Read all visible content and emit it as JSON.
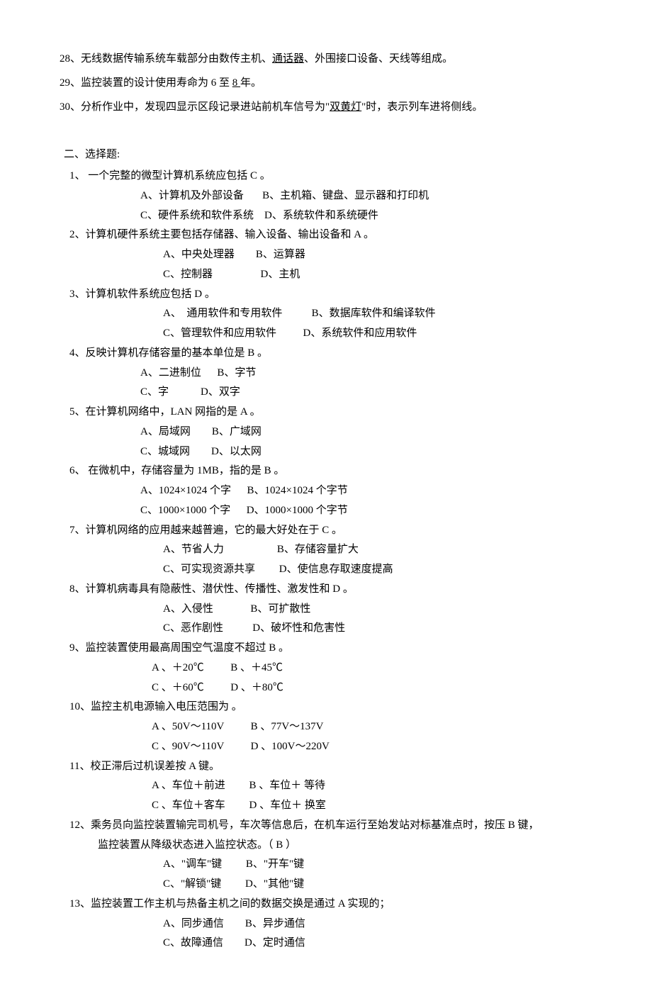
{
  "fill": {
    "q28": {
      "pre": "28、无线数据传输系统车载部分由数传主机、",
      "u": "通话器",
      "post": "、外围接口设备、天线等组成。"
    },
    "q29": {
      "pre": "29、监控装置的设计使用寿命为 6 至 ",
      "u": "8 ",
      "post": "年。"
    },
    "q30": {
      "pre": "30、分析作业中，发现四显示区段记录进站前机车信号为\"",
      "u": "双黄灯",
      "post": "\"时，表示列车进将侧线。"
    }
  },
  "sectionTitle": "二、选择题:",
  "mc": {
    "q1": {
      "stem": "1、  一个完整的微型计算机系统应包括  C   。",
      "row1": "A、计算机及外部设备       B、主机箱、键盘、显示器和打印机",
      "row2": "C、硬件系统和软件系统    D、系统软件和系统硬件"
    },
    "q2": {
      "stem": "2、计算机硬件系统主要包括存储器、输入设备、输出设备和 A   。",
      "row1": "A、中央处理器        B、运算器",
      "row2": "C、控制器                  D、主机"
    },
    "q3": {
      "stem": "3、计算机软件系统应包括 D   。",
      "row1": "A、  通用软件和专用软件           B、数据库软件和编译软件",
      "row2": "C、管理软件和应用软件          D、系统软件和应用软件"
    },
    "q4": {
      "stem": "4、反映计算机存储容量的基本单位是   B  。",
      "row1": "A、二进制位      B、字节",
      "row2": "C、字            D、双字"
    },
    "q5": {
      "stem": "5、在计算机网络中，LAN 网指的是  A  。",
      "row1": "A、局域网        B、广域网",
      "row2": "C、城域网        D、以太网"
    },
    "q6": {
      "stem": "6、  在微机中，存储容量为 1MB，指的是  B   。",
      "row1": "A、1024×1024 个字      B、1024×1024 个字节",
      "row2": "C、1000×1000 个字      D、1000×1000 个字节"
    },
    "q7": {
      "stem": "7、计算机网络的应用越来越普遍，它的最大好处在于 C   。",
      "row1": "A、节省人力                    B、存储容量扩大",
      "row2": "C、可实现资源共享         D、使信息存取速度提高"
    },
    "q8": {
      "stem": "8、计算机病毒具有隐蔽性、潜伏性、传播性、激发性和  D  。",
      "row1": "A、入侵性              B、可扩散性",
      "row2": "C、恶作剧性           D、破坏性和危害性"
    },
    "q9": {
      "stem": "9、监控装置使用最高周围空气温度不超过  B  。",
      "row1": "A 、＋20℃          B 、＋45℃",
      "row2": "C 、＋60℃          D 、＋80℃"
    },
    "q10": {
      "stem": "10、监控主机电源输入电压范围为     。",
      "row1": "A 、50V～110V          B 、77V～137V",
      "row2": "C 、90V～110V          D 、100V～220V"
    },
    "q11": {
      "stem": "11、校正滞后过机误差按  A  键。",
      "row1": "A 、车位＋前进         B 、车位＋ 等待",
      "row2": "C 、车位＋客车         D 、车位＋ 换室"
    },
    "q12": {
      "stem": "12、乘务员向监控装置输完司机号，车次等信息后，在机车运行至始发站对标基准点时，按压   B  键，",
      "stem2": "监控装置从降级状态进入监控状态。（ B    ）",
      "row1": "A、\"调车\"键         B、\"开车\"键",
      "row2": "C、\"解锁\"键         D、\"其他\"键"
    },
    "q13": {
      "stem": "13、监控装置工作主机与热备主机之间的数据交换是通过  A   实现的；",
      "row1": "A、同步通信        B、异步通信",
      "row2": "C、故障通信        D、定时通信"
    }
  }
}
